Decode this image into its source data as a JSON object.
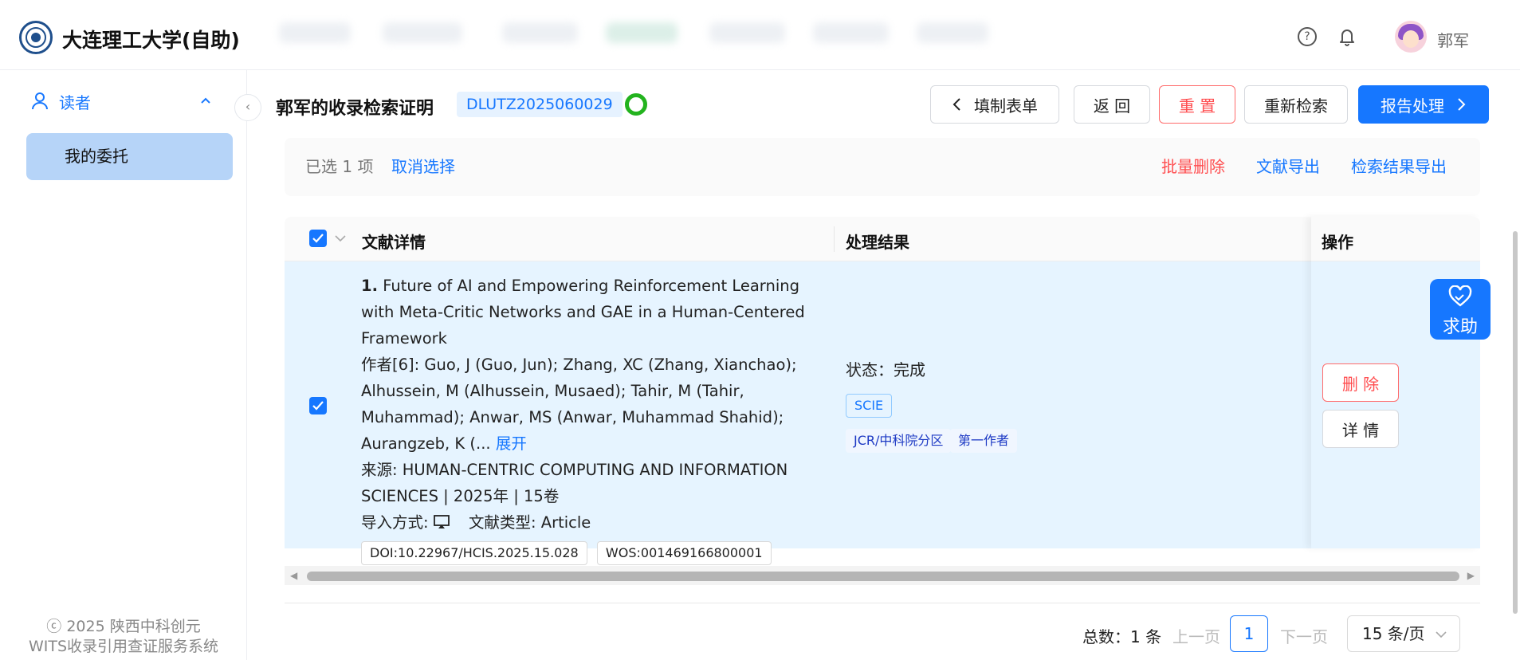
{
  "app": {
    "brand": "大连理工大学(自助)",
    "user_name": "郭军"
  },
  "sidebar": {
    "section_label": "读者",
    "items": [
      {
        "label": "我的委托"
      }
    ],
    "copyright_line1": "ⓒ 2025  陕西中科创元",
    "copyright_line2": "WITS收录引用查证服务系统"
  },
  "header": {
    "title": "郭军的收录检索证明",
    "id_tag": "DLUTZ2025060029",
    "buttons": {
      "fill_form": "填制表单",
      "back": "返 回",
      "reset": "重 置",
      "research": "重新检索",
      "report": "报告处理"
    }
  },
  "selection": {
    "selected_text": "已选 1 项",
    "cancel": "取消选择",
    "batch_delete": "批量删除",
    "export_docs": "文献导出",
    "export_results": "检索结果导出"
  },
  "table": {
    "columns": [
      "文献详情",
      "处理结果",
      "操作"
    ],
    "rows": [
      {
        "index": "1.",
        "title": "Future of AI and Empowering Reinforcement Learning with Meta-Critic Networks and GAE in a Human-Centered Framework",
        "authors_prefix": "作者[6]:",
        "authors": "Guo, J (Guo, Jun); Zhang, XC (Zhang, Xianchao); Alhussein, M (Alhussein, Musaed); Tahir, M (Tahir, Muhammad); Anwar, MS (Anwar, Muhammad Shahid); Aurangzeb, K (...",
        "expand": "展开",
        "source": "来源: HUMAN-CENTRIC COMPUTING AND INFORMATION SCIENCES | 2025年 | 15卷",
        "import_label": "导入方式:",
        "doc_type": "文献类型: Article",
        "doi": "DOI:10.22967/HCIS.2025.15.028",
        "wos": "WOS:001469166800001",
        "status": "状态：完成",
        "tag_index": "SCIE",
        "tag_jcr": "JCR/中科院分区",
        "tag_author": "第一作者",
        "op_delete": "删 除",
        "op_detail": "详 情"
      }
    ]
  },
  "pagination": {
    "total": "总数：1 条",
    "prev": "上一页",
    "current": "1",
    "next": "下一页",
    "page_size": "15 条/页"
  },
  "float_help": {
    "label": "求助"
  },
  "colors": {
    "primary": "#1677ff",
    "danger": "#ff4d4f",
    "success": "#23b31e",
    "row_selected": "#e6f4ff"
  }
}
